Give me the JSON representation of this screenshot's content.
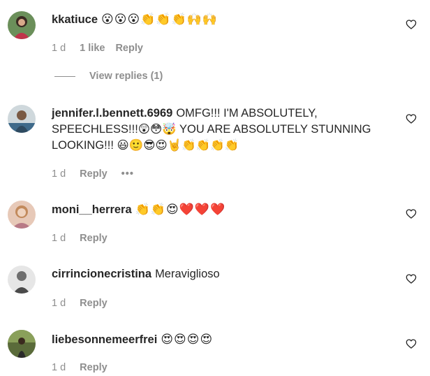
{
  "comments": [
    {
      "username": "kkatiuce",
      "text": "",
      "emojis": "😮😮😮👏👏👏🙌🙌",
      "age": "1 d",
      "likes": "1 like",
      "reply": "Reply",
      "view_replies": "View replies (1)"
    },
    {
      "username": "jennifer.l.bennett.6969",
      "text": "OMFG!!! I'M ABSOLUTELY, SPEECHLESS!!!😲😳🤯 YOU ARE ABSOLUTELY STUNNING LOOKING!!! 😃🙂😎😍🤘👏👏👏👏",
      "emojis": "",
      "age": "1 d",
      "reply": "Reply",
      "more": "•••"
    },
    {
      "username": "moni__herrera",
      "text": "",
      "emojis": "👏👏😍❤️❤️❤️",
      "age": "1 d",
      "reply": "Reply"
    },
    {
      "username": "cirrincionecristina",
      "text": "Meraviglioso",
      "emojis": "",
      "age": "1 d",
      "reply": "Reply"
    },
    {
      "username": "liebesonnemeerfrei",
      "text": "",
      "emojis": "😍😍😍😍",
      "age": "1 d",
      "reply": "Reply"
    }
  ],
  "icons": {
    "like": "heart-outline-icon",
    "avatar": "user-avatar"
  },
  "colors": {
    "text": "#262626",
    "secondary": "#8e8e8e"
  }
}
